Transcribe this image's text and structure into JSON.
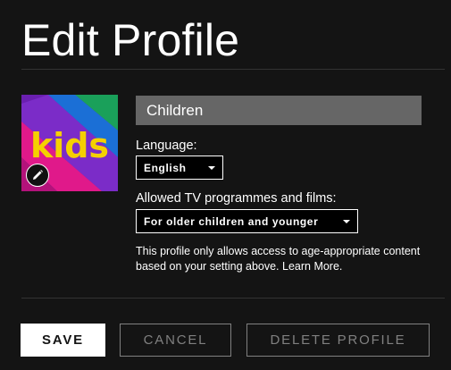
{
  "page": {
    "title": "Edit Profile"
  },
  "profile": {
    "name": "Children",
    "avatar_text": "kids",
    "avatar_icon": "pencil-icon"
  },
  "language": {
    "label": "Language:",
    "selected": "English"
  },
  "maturity": {
    "label": "Allowed TV programmes and films:",
    "selected": "For older children and younger",
    "description": "This profile only allows access to age-appropriate content based on your setting above. Learn More."
  },
  "buttons": {
    "save": "SAVE",
    "cancel": "CANCEL",
    "delete": "DELETE PROFILE"
  },
  "colors": {
    "background": "#141414",
    "input_fill": "#666666",
    "muted": "#808080",
    "kids_yellow": "#f5d000"
  }
}
